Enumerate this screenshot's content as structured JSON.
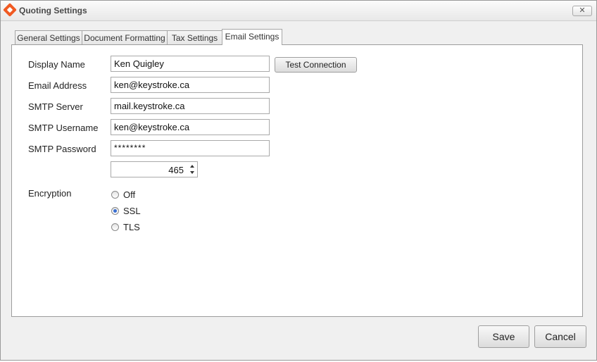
{
  "window": {
    "title": "Quoting Settings",
    "close_glyph": "✕"
  },
  "tabs": [
    {
      "label": "General Settings"
    },
    {
      "label": "Document Formatting"
    },
    {
      "label": "Tax Settings"
    },
    {
      "label": "Email Settings"
    }
  ],
  "active_tab": "Email Settings",
  "form": {
    "display_name": {
      "label": "Display Name",
      "value": "Ken Quigley"
    },
    "email_address": {
      "label": "Email Address",
      "value": "ken@keystroke.ca"
    },
    "smtp_server": {
      "label": "SMTP Server",
      "value": "mail.keystroke.ca"
    },
    "smtp_username": {
      "label": "SMTP Username",
      "value": "ken@keystroke.ca"
    },
    "smtp_password": {
      "label": "SMTP Password",
      "value": "********"
    },
    "port": {
      "value": "465"
    },
    "encryption": {
      "label": "Encryption",
      "options": [
        "Off",
        "SSL",
        "TLS"
      ],
      "selected": "SSL"
    }
  },
  "buttons": {
    "test_connection": "Test Connection",
    "save": "Save",
    "cancel": "Cancel"
  },
  "colors": {
    "brand": "#f05a22",
    "radio_selected": "#3a6fd2"
  }
}
